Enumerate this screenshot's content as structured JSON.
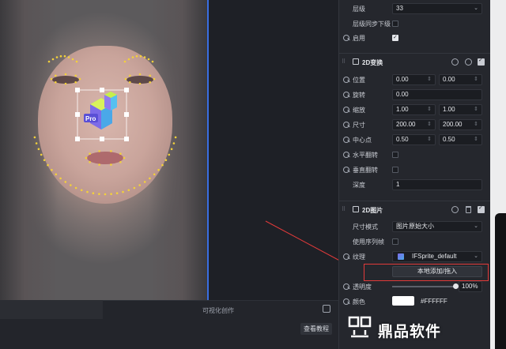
{
  "colors": {
    "accent_blue": "#3a6ee0",
    "highlight_red": "#e23a3a",
    "panel_bg": "#25272d",
    "landmark_dots": "#f3d13a"
  },
  "viewport": {
    "sticker_badge": "Pro"
  },
  "bottom": {
    "visual_title": "可视化创作",
    "tutorial_button": "查看教程"
  },
  "layer": {
    "level_label": "层级",
    "level_value": "33",
    "sync_label": "层级同步下级",
    "sync_checked": false,
    "enable_label": "启用",
    "enable_checked": true
  },
  "transform2d": {
    "title": "2D变换",
    "position_label": "位置",
    "position_x": "0.00",
    "position_y": "0.00",
    "rotation_label": "旋转",
    "rotation_value": "0.00",
    "scale_label": "缩放",
    "scale_x": "1.00",
    "scale_y": "1.00",
    "size_label": "尺寸",
    "size_w": "200.00",
    "size_h": "200.00",
    "pivot_label": "中心点",
    "pivot_x": "0.50",
    "pivot_y": "0.50",
    "flip_h_label": "水平翻转",
    "flip_h_checked": false,
    "flip_v_label": "垂直翻转",
    "flip_v_checked": false,
    "depth_label": "深度",
    "depth_value": "1"
  },
  "image2d": {
    "title": "2D图片",
    "size_mode_label": "尺寸模式",
    "size_mode_value": "图片原始大小",
    "sequence_label": "使用序列帧",
    "sequence_checked": false,
    "texture_label": "纹理",
    "texture_value": "IFSprite_default",
    "local_add_button": "本地添加/拖入",
    "opacity_label": "透明度",
    "opacity_value": "100%",
    "opacity_fraction": 1.0,
    "color_label": "颜色",
    "color_value": "#FFFFFF"
  },
  "watermark": {
    "text": "鼎品软件"
  }
}
